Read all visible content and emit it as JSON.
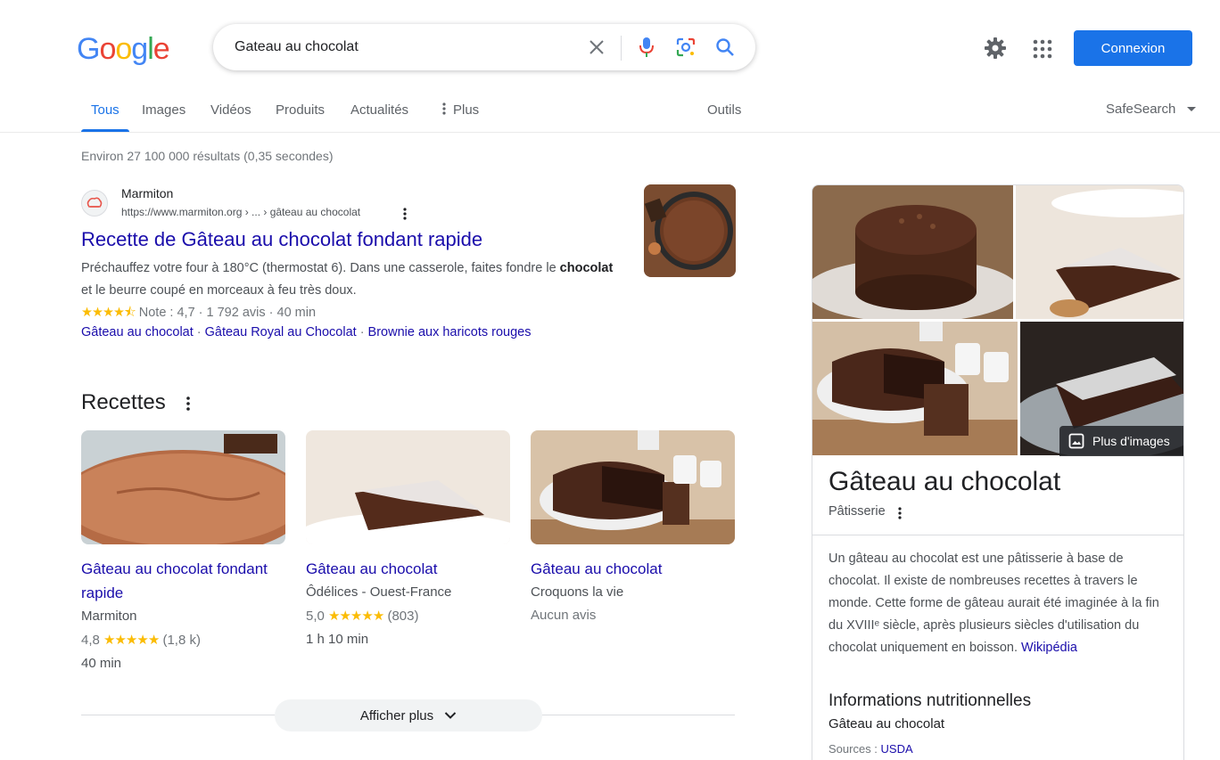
{
  "logo": "Google",
  "search": {
    "value": "Gateau au chocolat"
  },
  "header": {
    "signin_label": "Connexion"
  },
  "tabs": [
    "Tous",
    "Images",
    "Vidéos",
    "Produits",
    "Actualités",
    "Plus"
  ],
  "tools_label": "Outils",
  "safesearch_label": "SafeSearch",
  "stats": "Environ 27 100 000 résultats (0,35 secondes)",
  "result": {
    "site_name": "Marmiton",
    "url": "https://www.marmiton.org › ... › gâteau au chocolat",
    "title": "Recette de Gâteau au chocolat fondant rapide",
    "snippet_1": "Préchauffez votre four à 180°C (thermostat 6). Dans une casserole, faites fondre le ",
    "snippet_bold": "chocolat",
    "snippet_2": " et le beurre coupé en morceaux à feu très doux.",
    "stars": "★★★★⯪",
    "rating_text": "Note : 4,7 · 1 792 avis · 40 min",
    "sublinks": [
      "Gâteau au chocolat",
      "Gâteau Royal au Chocolat",
      "Brownie aux haricots rouges"
    ],
    "sublink_sep": "·"
  },
  "recipes": {
    "heading": "Recettes",
    "items": [
      {
        "title": "Gâteau au chocolat fondant rapide",
        "source": "Marmiton",
        "rating": "4,8",
        "stars": "★★★★★",
        "count": "(1,8 k)",
        "time": "40 min"
      },
      {
        "title": "Gâteau au chocolat",
        "source": "Ôdélices - Ouest-France",
        "rating": "5,0",
        "stars": "★★★★★",
        "count": "(803)",
        "time": "1 h 10 min"
      },
      {
        "title": "Gâteau au chocolat",
        "source": "Croquons la vie",
        "no_reviews": "Aucun avis"
      }
    ],
    "more_label": "Afficher plus"
  },
  "knowledge_panel": {
    "more_images_label": "Plus d'images",
    "title": "Gâteau au chocolat",
    "subtitle": "Pâtisserie",
    "description": "Un gâteau au chocolat est une pâtisserie à base de chocolat. Il existe de nombreuses recettes à travers le monde. Cette forme de gâteau aurait été imaginée à la fin du XVIIIᵉ siècle, après plusieurs siècles d'utilisation du chocolat uniquement en boisson. ",
    "description_link": "Wikipédia",
    "nutrition_title": "Informations nutritionnelles",
    "nutrition_item": "Gâteau au chocolat",
    "sources_label": "Sources : ",
    "sources_link": "USDA"
  },
  "colors": {
    "accent": "#1a73e8",
    "link": "#1a0dab",
    "star": "#fbbc04"
  }
}
